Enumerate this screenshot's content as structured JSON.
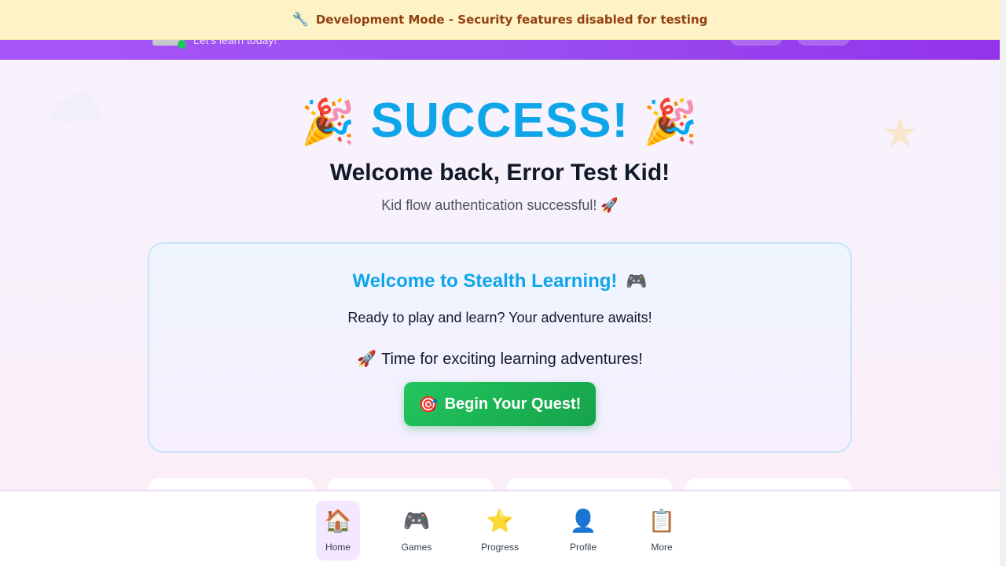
{
  "banner": {
    "icon": "wrench-icon",
    "icon_glyph": "🔧",
    "text": "Development Mode - Security features disabled for testing"
  },
  "header": {
    "tagline": "Let's learn today!"
  },
  "hero": {
    "party_glyph": "🎉",
    "title": "SUCCESS!",
    "welcome": "Welcome back, Error Test Kid!",
    "subtitle": "Kid flow authentication successful! 🚀"
  },
  "card": {
    "title": "Welcome to Stealth Learning!",
    "title_glyph": "🎮",
    "text": "Ready to play and learn? Your adventure awaits!",
    "time_glyph": "🚀",
    "time_text": "Time for exciting learning adventures!",
    "button_glyph": "🎯",
    "button_label": "Begin Your Quest!"
  },
  "nav": {
    "items": [
      {
        "label": "Home",
        "icon": "house-icon",
        "glyph": "🏠",
        "active": true
      },
      {
        "label": "Games",
        "icon": "gamepad-icon",
        "glyph": "🎮",
        "active": false
      },
      {
        "label": "Progress",
        "icon": "star-icon",
        "glyph": "⭐",
        "active": false
      },
      {
        "label": "Profile",
        "icon": "user-icon",
        "glyph": "👤",
        "active": false
      },
      {
        "label": "More",
        "icon": "clipboard-icon",
        "glyph": "📋",
        "active": false
      }
    ]
  },
  "colors": {
    "accent": "#0ea5e9",
    "header_purple": "#a855f7",
    "button_green": "#22c55e",
    "banner_bg": "#fef3c7",
    "banner_text": "#92400e"
  }
}
